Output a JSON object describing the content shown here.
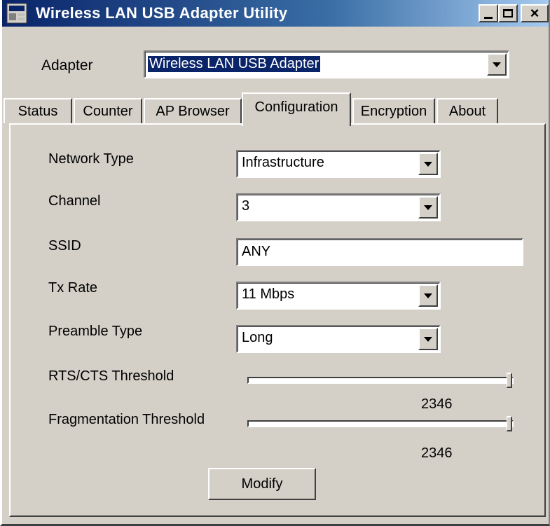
{
  "window": {
    "title": "Wireless LAN USB Adapter Utility",
    "icon": "wireless-utility-icon",
    "controls": [
      "minimize",
      "maximize",
      "close"
    ]
  },
  "adapter": {
    "label": "Adapter",
    "selected": "Wireless LAN USB Adapter"
  },
  "tabs": [
    {
      "label": "Status"
    },
    {
      "label": "Counter"
    },
    {
      "label": "AP Browser"
    },
    {
      "label": "Configuration",
      "active": true
    },
    {
      "label": "Encryption"
    },
    {
      "label": "About"
    }
  ],
  "config": {
    "network_type": {
      "label": "Network Type",
      "value": "Infrastructure"
    },
    "channel": {
      "label": "Channel",
      "value": "3"
    },
    "ssid": {
      "label": "SSID",
      "value": "ANY"
    },
    "tx_rate": {
      "label": "Tx Rate",
      "value": "11 Mbps"
    },
    "preamble_type": {
      "label": "Preamble Type",
      "value": "Long"
    },
    "rts_cts": {
      "label": "RTS/CTS Threshold",
      "value": "2346",
      "level_fraction": 1.0
    },
    "fragmentation": {
      "label": "Fragmentation Threshold",
      "value": "2346",
      "level_fraction": 1.0
    },
    "modify_label": "Modify"
  },
  "colors": {
    "titlebar_start": "#0a246a",
    "titlebar_end": "#a6caf0",
    "face": "#d4d0c8",
    "selection": "#0a246a"
  }
}
